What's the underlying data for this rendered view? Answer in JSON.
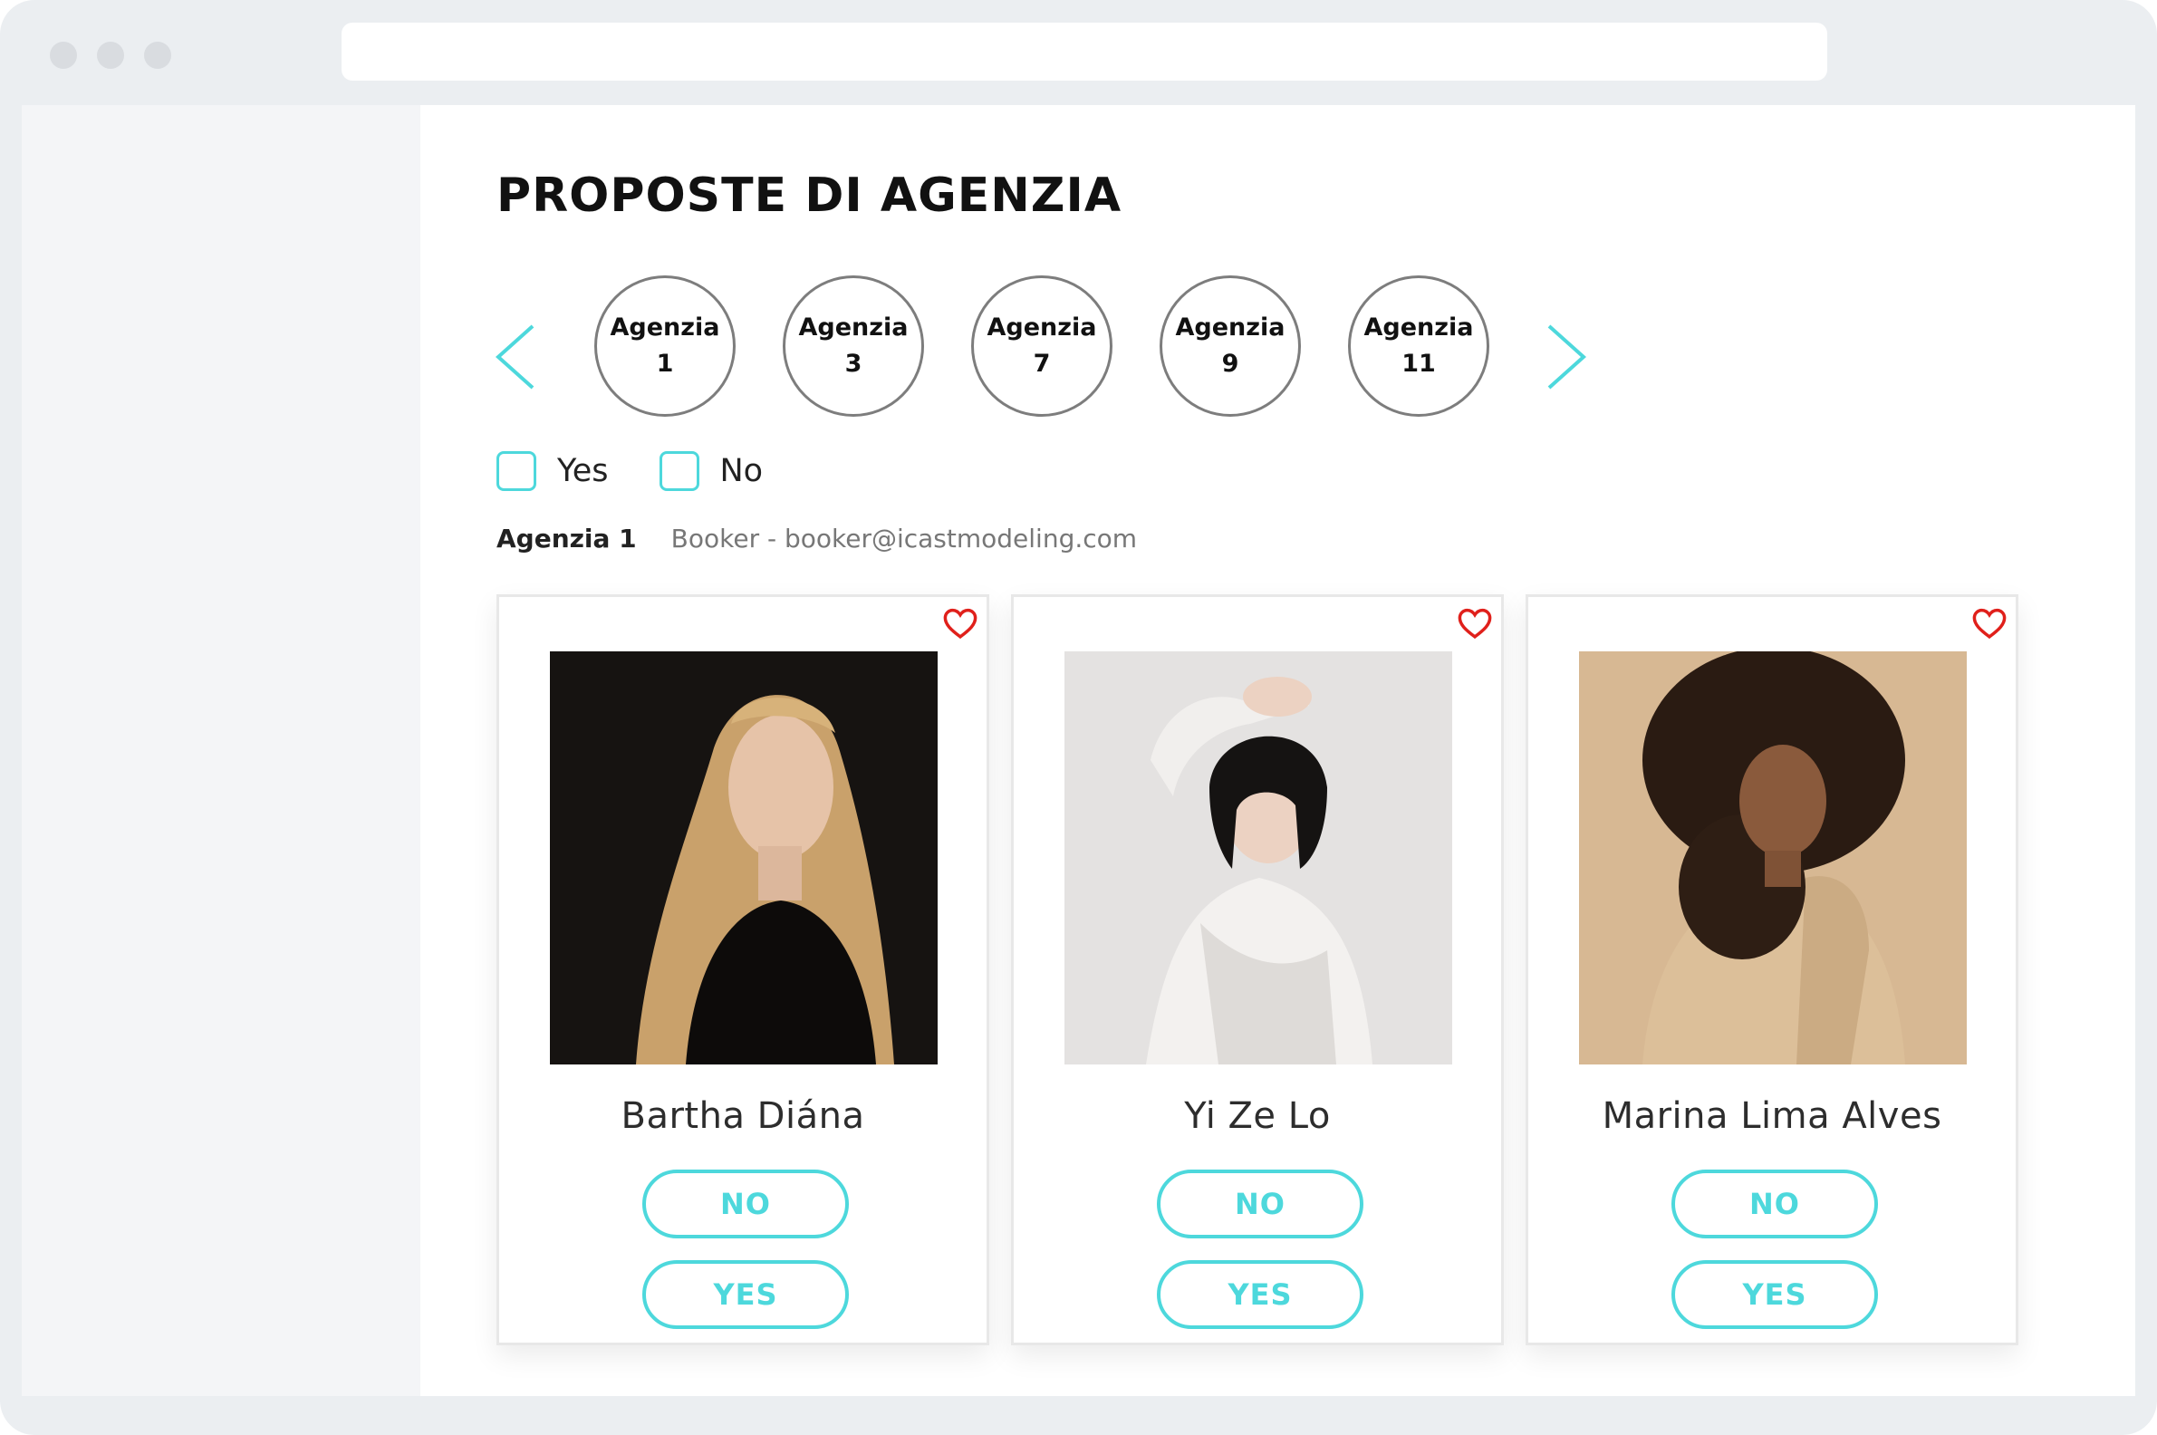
{
  "browser": {
    "url": ""
  },
  "page": {
    "title": "PROPOSTE DI AGENZIA"
  },
  "carousel": {
    "prev_icon": "chevron-left-icon",
    "next_icon": "chevron-right-icon",
    "agencies": [
      {
        "label": "Agenzia",
        "number": "1"
      },
      {
        "label": "Agenzia",
        "number": "3"
      },
      {
        "label": "Agenzia",
        "number": "7"
      },
      {
        "label": "Agenzia",
        "number": "9"
      },
      {
        "label": "Agenzia",
        "number": "11"
      }
    ]
  },
  "filters": [
    {
      "label": "Yes",
      "checked": false
    },
    {
      "label": "No",
      "checked": false
    }
  ],
  "agency_info": {
    "name": "Agenzia 1",
    "contact": "Booker - booker@icastmodeling.com"
  },
  "cards": [
    {
      "name": "Bartha Diána",
      "no_label": "NO",
      "yes_label": "YES",
      "favorite_icon": "heart-icon"
    },
    {
      "name": "Yi Ze Lo",
      "no_label": "NO",
      "yes_label": "YES",
      "favorite_icon": "heart-icon"
    },
    {
      "name": "Marina Lima Alves",
      "no_label": "NO",
      "yes_label": "YES",
      "favorite_icon": "heart-icon"
    }
  ],
  "colors": {
    "accent": "#4dd8dc",
    "heart": "#e0201b",
    "title": "#111111"
  }
}
